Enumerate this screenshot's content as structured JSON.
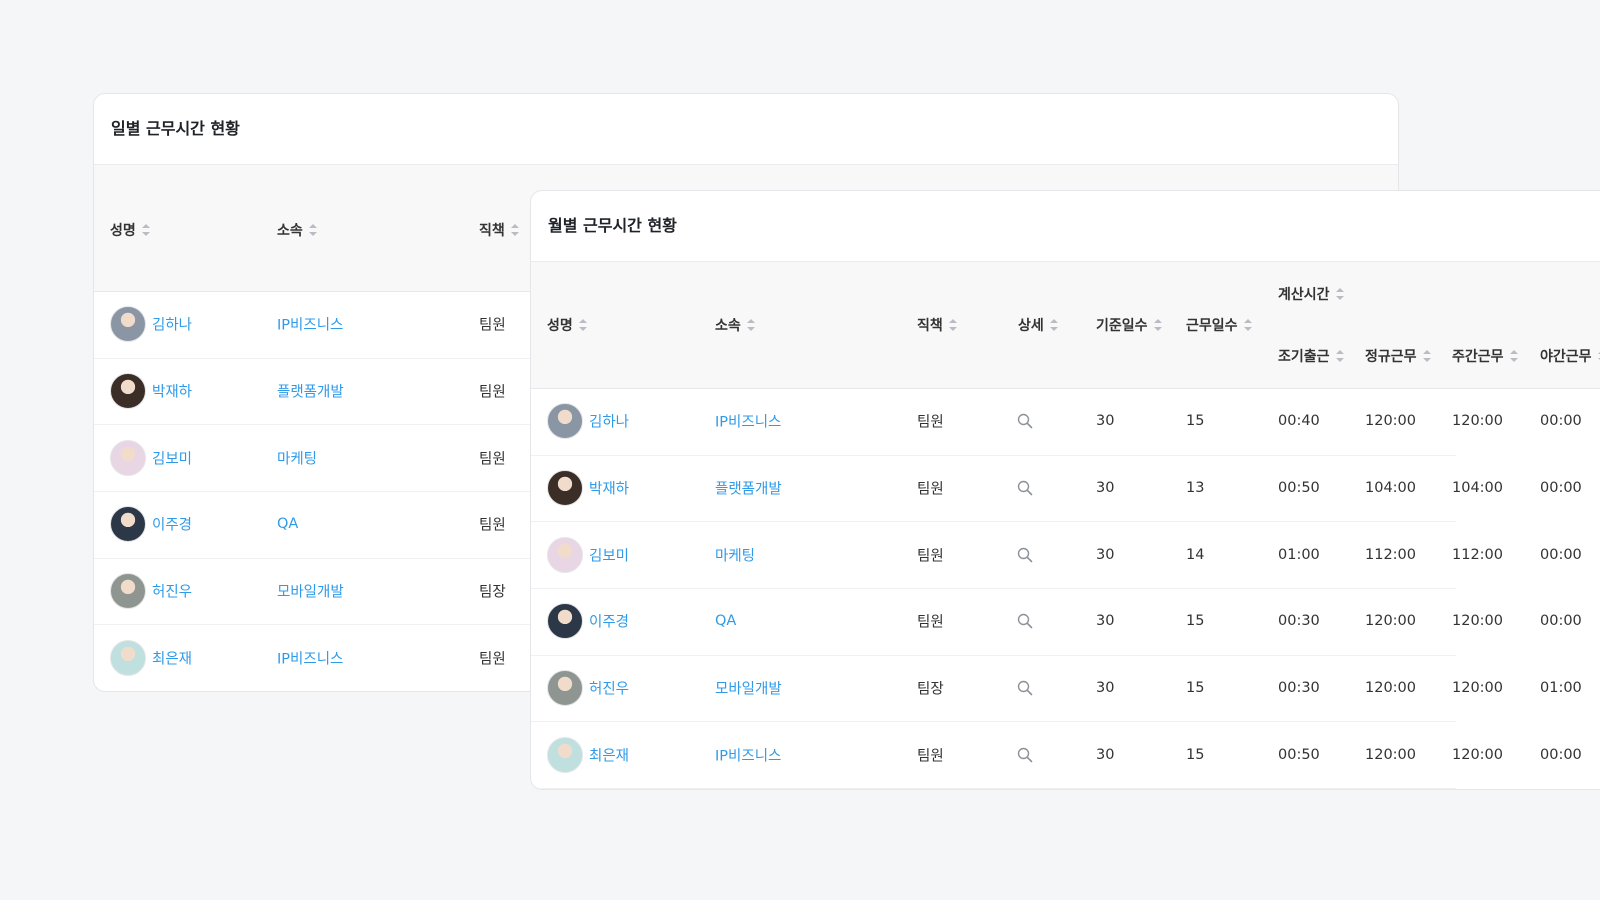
{
  "daily": {
    "title": "일별 근무시간 현황",
    "headers": {
      "name": "성명",
      "dept": "소속",
      "position": "직책"
    },
    "rows": [
      {
        "name": "김하나",
        "dept": "IP비즈니스",
        "position": "팀원",
        "avatar_color": "#8a96a4"
      },
      {
        "name": "박재하",
        "dept": "플랫폼개발",
        "position": "팀원",
        "avatar_color": "#3b2e26"
      },
      {
        "name": "김보미",
        "dept": "마케팅",
        "position": "팀원",
        "avatar_color": "#e9d6e4"
      },
      {
        "name": "이주경",
        "dept": "QA",
        "position": "팀원",
        "avatar_color": "#2c3848"
      },
      {
        "name": "허진우",
        "dept": "모바일개발",
        "position": "팀장",
        "avatar_color": "#8f9692"
      },
      {
        "name": "최은재",
        "dept": "IP비즈니스",
        "position": "팀원",
        "avatar_color": "#bfe0de"
      }
    ]
  },
  "monthly": {
    "title": "월별 근무시간 현황",
    "headers": {
      "name": "성명",
      "dept": "소속",
      "position": "직책",
      "detail": "상세",
      "base_days": "기준일수",
      "work_days": "근무일수",
      "calc_group": "계산시간",
      "early": "조기출근",
      "regular": "정규근무",
      "daytime": "주간근무",
      "night": "야간근무"
    },
    "rows": [
      {
        "name": "김하나",
        "dept": "IP비즈니스",
        "position": "팀원",
        "base": "30",
        "work": "15",
        "early": "00:40",
        "regular": "120:00",
        "day": "120:00",
        "night": "00:00",
        "avatar_color": "#8a96a4"
      },
      {
        "name": "박재하",
        "dept": "플랫폼개발",
        "position": "팀원",
        "base": "30",
        "work": "13",
        "early": "00:50",
        "regular": "104:00",
        "day": "104:00",
        "night": "00:00",
        "avatar_color": "#3b2e26"
      },
      {
        "name": "김보미",
        "dept": "마케팅",
        "position": "팀원",
        "base": "30",
        "work": "14",
        "early": "01:00",
        "regular": "112:00",
        "day": "112:00",
        "night": "00:00",
        "avatar_color": "#e9d6e4"
      },
      {
        "name": "이주경",
        "dept": "QA",
        "position": "팀원",
        "base": "30",
        "work": "15",
        "early": "00:30",
        "regular": "120:00",
        "day": "120:00",
        "night": "00:00",
        "avatar_color": "#2c3848"
      },
      {
        "name": "허진우",
        "dept": "모바일개발",
        "position": "팀장",
        "base": "30",
        "work": "15",
        "early": "00:30",
        "regular": "120:00",
        "day": "120:00",
        "night": "01:00",
        "avatar_color": "#8f9692"
      },
      {
        "name": "최은재",
        "dept": "IP비즈니스",
        "position": "팀원",
        "base": "30",
        "work": "15",
        "early": "00:50",
        "regular": "120:00",
        "day": "120:00",
        "night": "00:00",
        "avatar_color": "#bfe0de"
      }
    ]
  }
}
